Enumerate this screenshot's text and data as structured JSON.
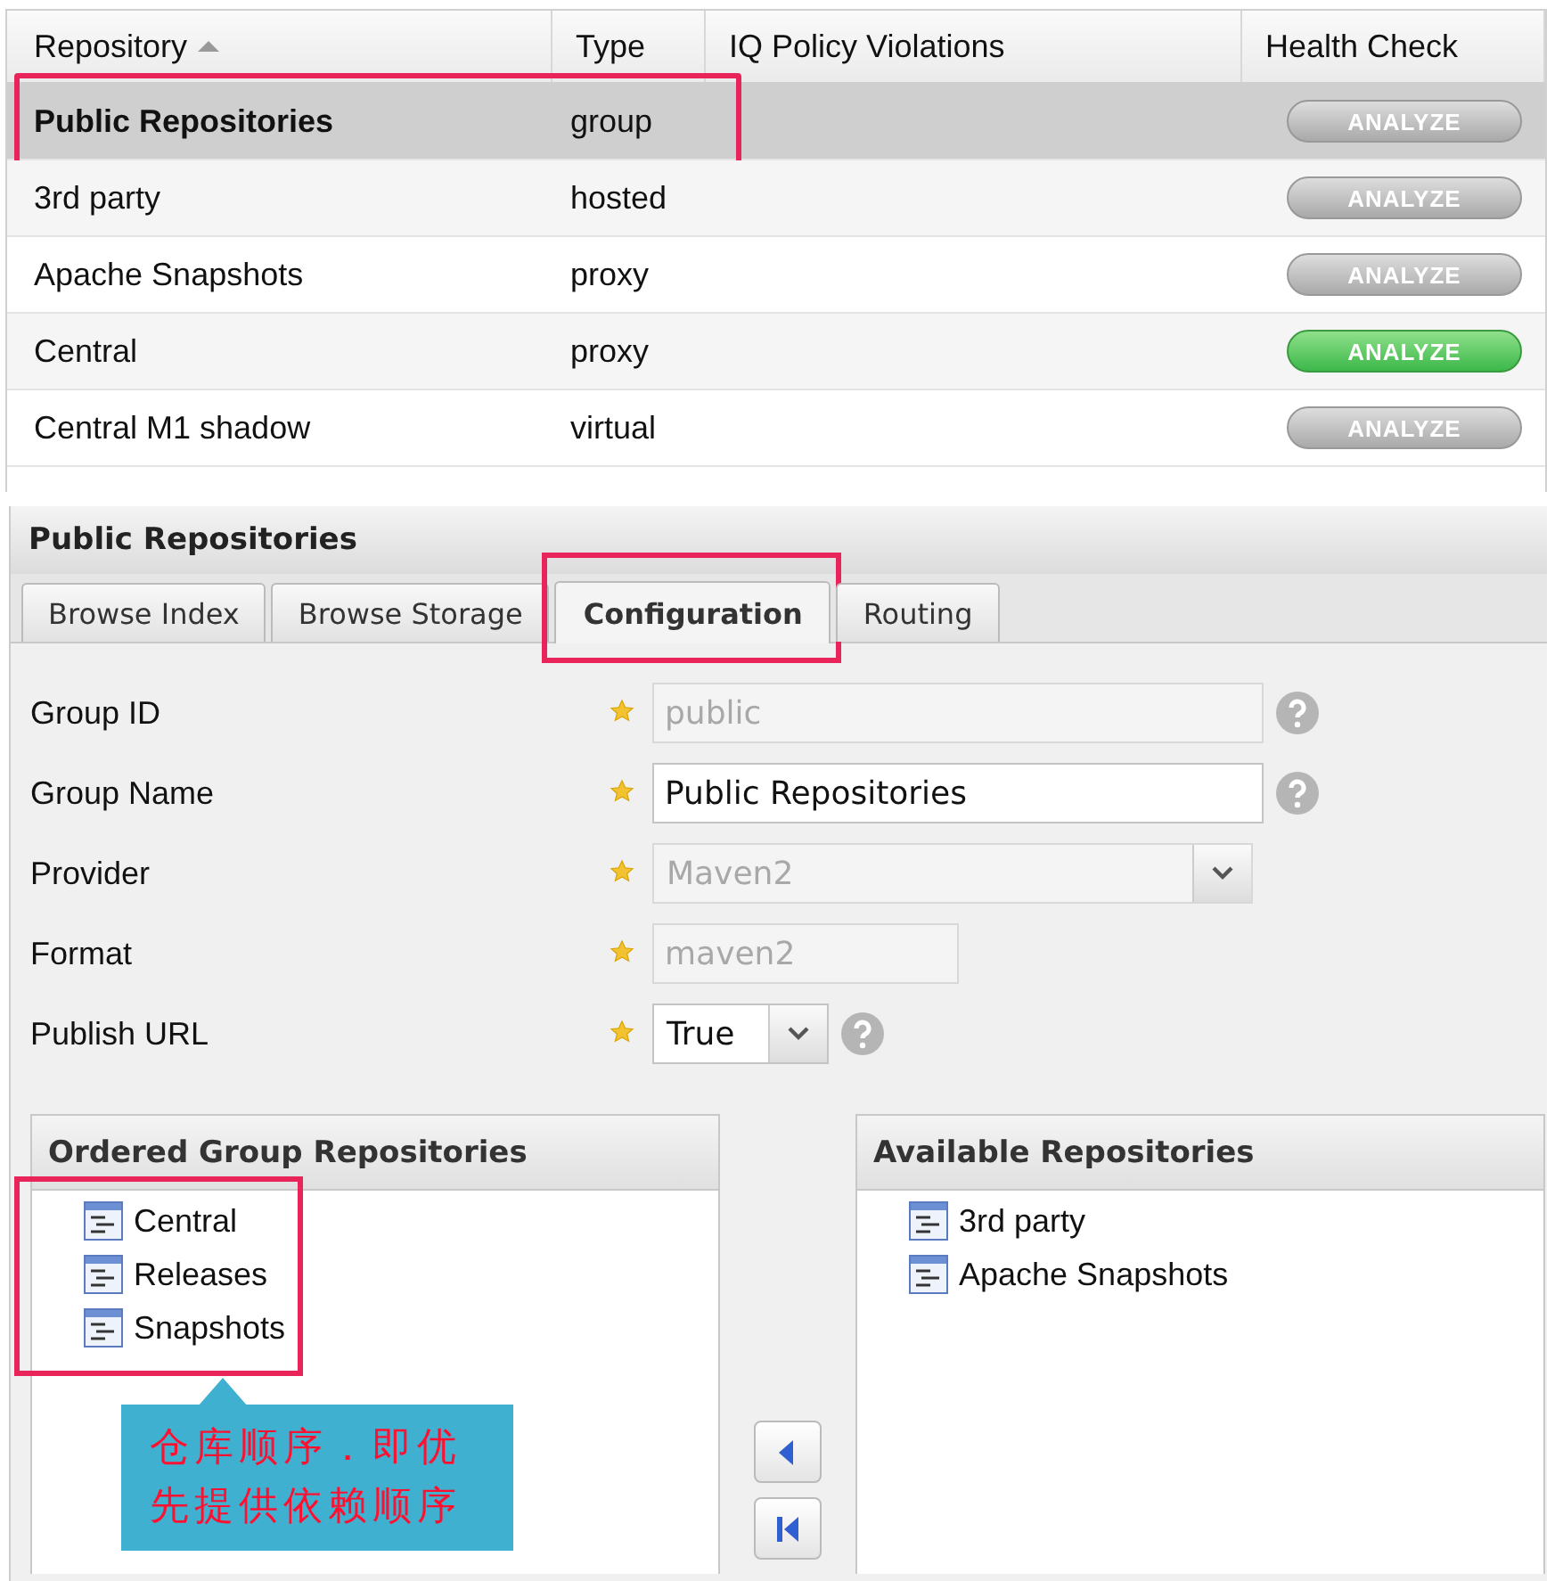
{
  "repository_grid": {
    "columns": [
      {
        "label": "Repository",
        "sorted": true
      },
      {
        "label": "Type",
        "sorted": false
      },
      {
        "label": "IQ Policy Violations",
        "sorted": false
      },
      {
        "label": "Health Check",
        "sorted": false
      }
    ],
    "rows": [
      {
        "name": "Public Repositories",
        "type": "group",
        "health_check": "ANALYZE",
        "health_active": false,
        "selected": true,
        "highlighted": true
      },
      {
        "name": "3rd party",
        "type": "hosted",
        "health_check": "ANALYZE",
        "health_active": false,
        "selected": false,
        "highlighted": false
      },
      {
        "name": "Apache Snapshots",
        "type": "proxy",
        "health_check": "ANALYZE",
        "health_active": false,
        "selected": false,
        "highlighted": false
      },
      {
        "name": "Central",
        "type": "proxy",
        "health_check": "ANALYZE",
        "health_active": true,
        "selected": false,
        "highlighted": false
      },
      {
        "name": "Central M1 shadow",
        "type": "virtual",
        "health_check": "ANALYZE",
        "health_active": false,
        "selected": false,
        "highlighted": false
      }
    ]
  },
  "detail_panel": {
    "title": "Public Repositories",
    "tabs": [
      {
        "label": "Browse Index",
        "selected": false,
        "highlighted": false
      },
      {
        "label": "Browse Storage",
        "selected": false,
        "highlighted": false
      },
      {
        "label": "Configuration",
        "selected": true,
        "highlighted": true
      },
      {
        "label": "Routing",
        "selected": false,
        "highlighted": false
      }
    ],
    "fields": [
      {
        "label": "Group ID",
        "kind": "text",
        "value": "public",
        "disabled": true,
        "required": true,
        "help": true
      },
      {
        "label": "Group Name",
        "kind": "text",
        "value": "Public Repositories",
        "disabled": false,
        "required": true,
        "help": true
      },
      {
        "label": "Provider",
        "kind": "select",
        "value": "Maven2",
        "disabled": true,
        "required": true,
        "help": false
      },
      {
        "label": "Format",
        "kind": "text",
        "value": "maven2",
        "disabled": true,
        "required": true,
        "help": false
      },
      {
        "label": "Publish URL",
        "kind": "select",
        "value": "True",
        "disabled": false,
        "required": true,
        "help": true
      }
    ],
    "ordered_group": {
      "title": "Ordered Group Repositories",
      "highlighted": true,
      "items": [
        "Central",
        "Releases",
        "Snapshots"
      ]
    },
    "available": {
      "title": "Available Repositories",
      "items": [
        "3rd party",
        "Apache Snapshots"
      ]
    },
    "move_buttons": [
      {
        "kind": "left"
      },
      {
        "kind": "first"
      }
    ],
    "callout": {
      "text": "仓库顺序．即优先提供依赖顺序"
    }
  }
}
